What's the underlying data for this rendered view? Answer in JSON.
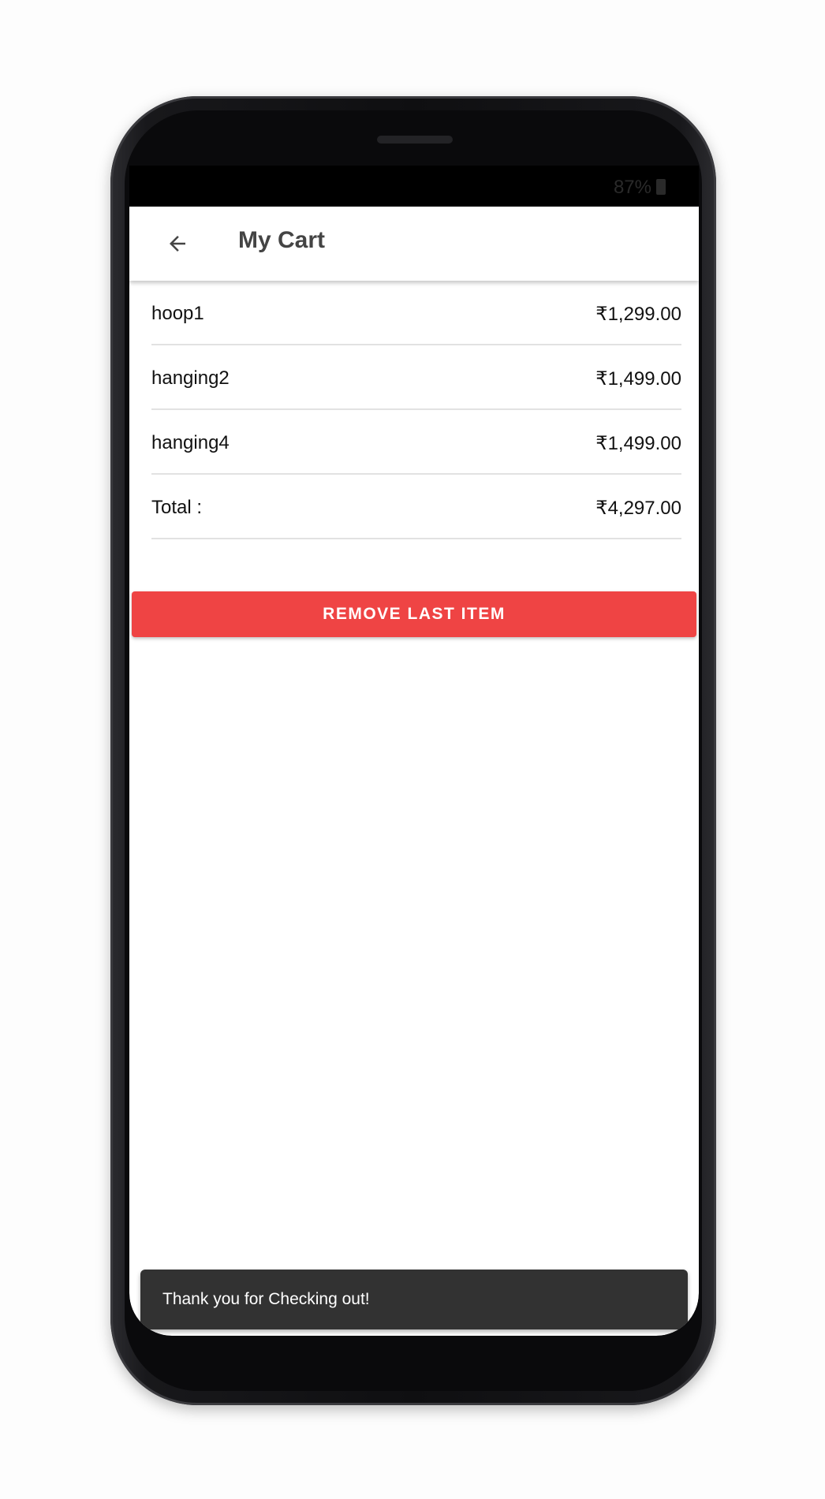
{
  "status_bar": {
    "battery_text": "87%",
    "battery_icon": "battery-icon"
  },
  "app_bar": {
    "back_icon": "arrow-back-icon",
    "title": "My Cart"
  },
  "cart": {
    "items": [
      {
        "name": "hoop1",
        "price": "₹1,299.00"
      },
      {
        "name": "hanging2",
        "price": "₹1,499.00"
      },
      {
        "name": "hanging4",
        "price": "₹1,499.00"
      }
    ],
    "total_label": "Total :",
    "total_value": "₹4,297.00"
  },
  "actions": {
    "remove_last_label": "REMOVE LAST ITEM"
  },
  "snackbar": {
    "message": "Thank you for Checking out!"
  },
  "colors": {
    "accent_red": "#ef4444",
    "snackbar_bg": "#323232",
    "title_text": "#444444"
  }
}
